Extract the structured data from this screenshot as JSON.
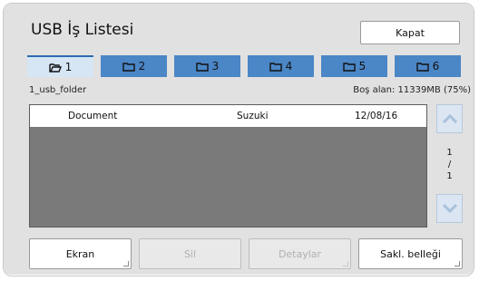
{
  "window": {
    "title": "USB İş Listesi",
    "close_label": "Kapat"
  },
  "tabs": [
    {
      "label": "1",
      "active": true,
      "icon": "open-folder-icon"
    },
    {
      "label": "2",
      "active": false,
      "icon": "folder-icon"
    },
    {
      "label": "3",
      "active": false,
      "icon": "folder-icon"
    },
    {
      "label": "4",
      "active": false,
      "icon": "folder-icon"
    },
    {
      "label": "5",
      "active": false,
      "icon": "folder-icon"
    },
    {
      "label": "6",
      "active": false,
      "icon": "folder-icon"
    }
  ],
  "folder": {
    "name": "1_usb_folder",
    "free_space": "Boş alan: 11339MB (75%)"
  },
  "jobs": [
    {
      "name": "Document",
      "owner": "Suzuki",
      "date": "12/08/16"
    }
  ],
  "pager": {
    "current": "1",
    "separator": "/",
    "total": "1"
  },
  "buttons": {
    "display": "Ekran",
    "delete": "Sil",
    "details": "Detaylar",
    "save_memory": "Sakl. belleği"
  },
  "colors": {
    "tab_active_bg": "#d6e6f5",
    "tab_inactive_bg": "#4b86c6",
    "panel_bg": "#e1e1e1",
    "list_bg": "#7a7a7a"
  }
}
